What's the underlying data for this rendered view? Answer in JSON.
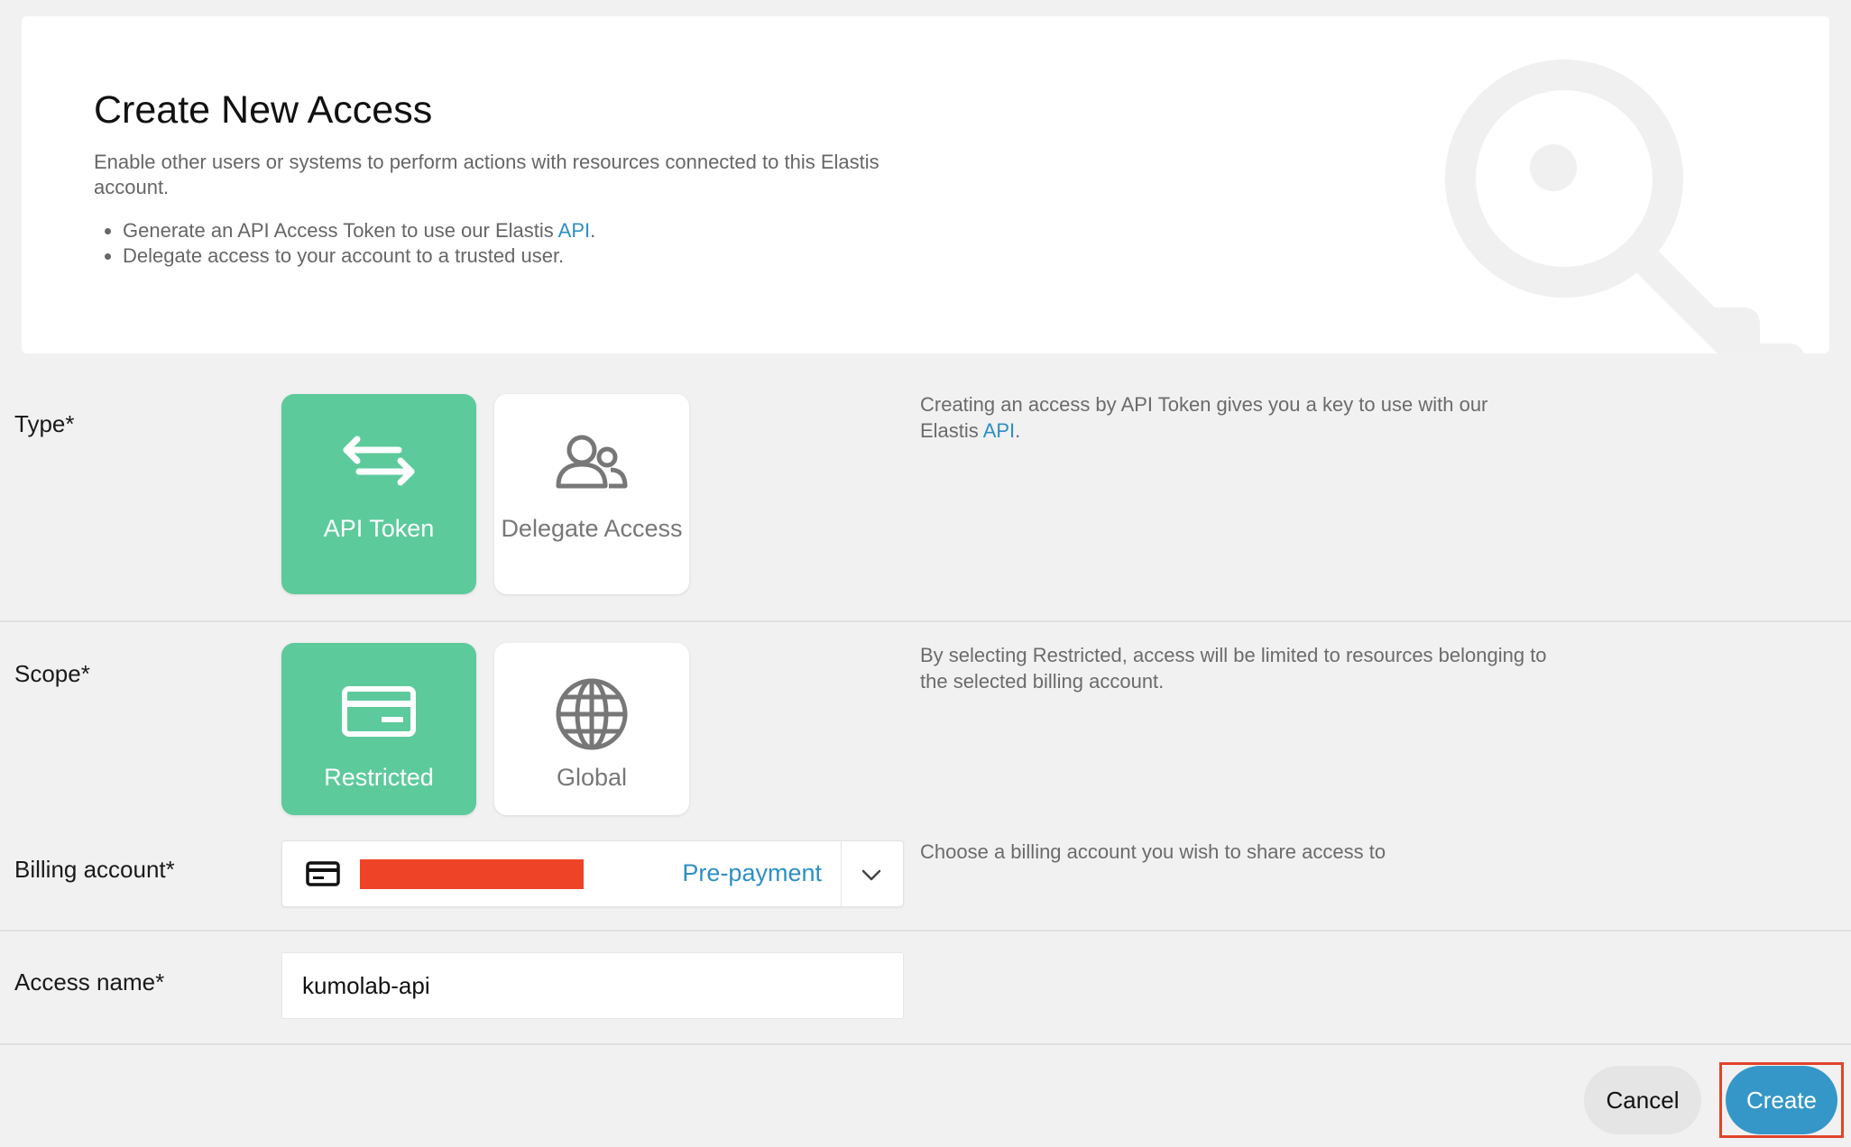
{
  "header": {
    "title": "Create New Access",
    "description": "Enable other users or systems to perform actions with resources connected to this Elastis account.",
    "bullets": [
      {
        "text": "Generate an API Access Token to use our Elastis ",
        "link": "API",
        "suffix": "."
      },
      {
        "text": "Delegate access to your account to a trusted user."
      }
    ]
  },
  "type_row": {
    "label": "Type*",
    "options": [
      {
        "label": "API Token",
        "icon": "arrows-exchange-icon",
        "selected": true
      },
      {
        "label": "Delegate Access",
        "icon": "users-icon",
        "selected": false
      }
    ],
    "helper_text": "Creating an access by API Token gives you a key to use with our Elastis ",
    "helper_link": "API",
    "helper_suffix": "."
  },
  "scope_row": {
    "label": "Scope*",
    "options": [
      {
        "label": "Restricted",
        "icon": "credit-card-icon",
        "selected": true
      },
      {
        "label": "Global",
        "icon": "globe-icon",
        "selected": false
      }
    ],
    "helper_text": "By selecting Restricted, access will be limited to resources belonging to the selected billing account."
  },
  "billing_row": {
    "label": "Billing account*",
    "selected_type": "Pre-payment",
    "helper_text": "Choose a billing account you wish to share access to"
  },
  "access_name_row": {
    "label": "Access name*",
    "value": "kumolab-api"
  },
  "footer": {
    "cancel_label": "Cancel",
    "create_label": "Create"
  },
  "colors": {
    "accent_green": "#5dca9c",
    "link_blue": "#2e8fc4",
    "primary_button": "#3597c8",
    "highlight_red": "#e2432b"
  }
}
